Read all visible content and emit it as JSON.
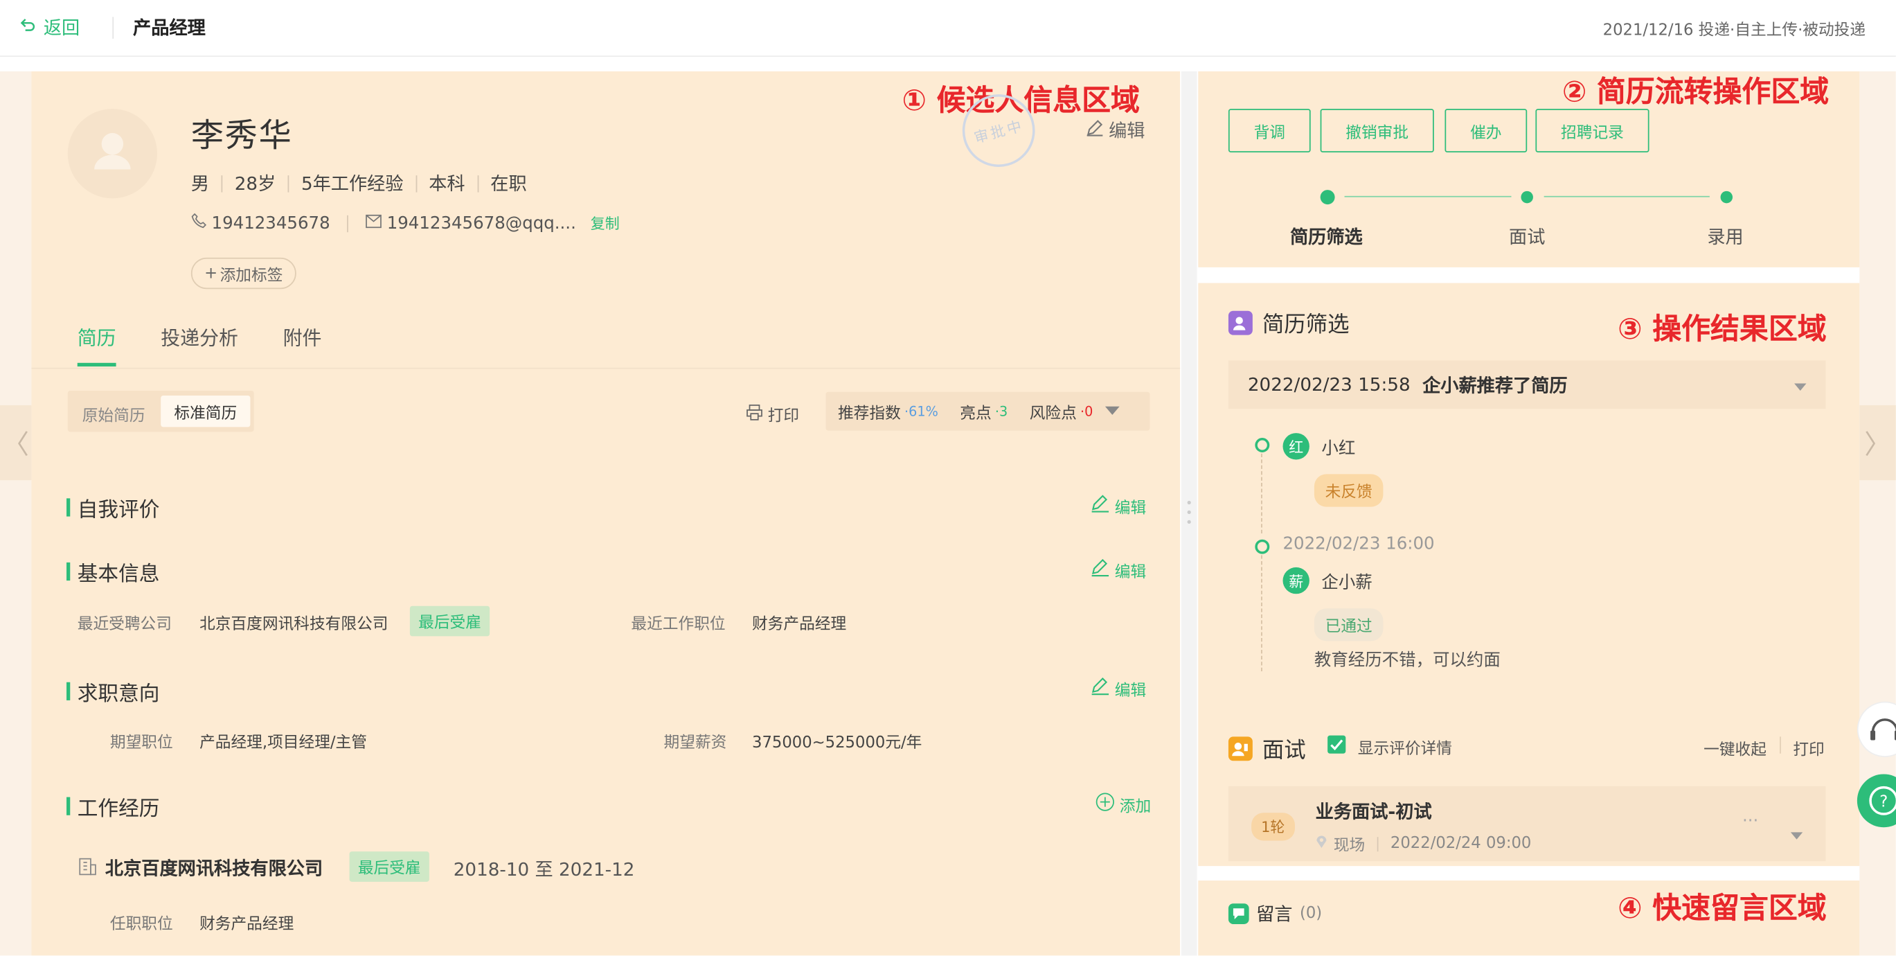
{
  "topbar": {
    "back_label": "返回",
    "page_title": "产品经理",
    "meta": "2021/12/16 投递·自主上传·被动投递"
  },
  "annotations": {
    "a1": "① 候选人信息区域",
    "a2": "② 简历流转操作区域",
    "a3": "③ 操作结果区域",
    "a4": "④ 快速留言区域"
  },
  "candidate": {
    "name": "李秀华",
    "stamp": "审批中",
    "edit_label": "编辑",
    "gender": "男",
    "age": "28岁",
    "experience": "5年工作经验",
    "education": "本科",
    "status": "在职",
    "phone": "19412345678",
    "email": "19412345678@qqq....",
    "copy_label": "复制",
    "add_tag_label": "添加标签"
  },
  "tabs": [
    {
      "label": "简历"
    },
    {
      "label": "投递分析"
    },
    {
      "label": "附件"
    }
  ],
  "resume_view": {
    "original_label": "原始简历",
    "standard_label": "标准简历",
    "print_label": "打印",
    "recommend_label": "推荐指数",
    "recommend_value": "·61%",
    "highlight_label": "亮点",
    "highlight_value": "·3",
    "risk_label": "风险点",
    "risk_value": "·0"
  },
  "sections": {
    "self_eval": {
      "title": "自我评价",
      "edit": "编辑"
    },
    "basic": {
      "title": "基本信息",
      "edit": "编辑",
      "company_label": "最近受聘公司",
      "company_value": "北京百度网讯科技有限公司",
      "company_badge": "最后受雇",
      "position_label": "最近工作职位",
      "position_value": "财务产品经理"
    },
    "intent": {
      "title": "求职意向",
      "edit": "编辑",
      "pos_label": "期望职位",
      "pos_value": "产品经理,项目经理/主管",
      "salary_label": "期望薪资",
      "salary_value": "375000~525000元/年"
    },
    "work": {
      "title": "工作经历",
      "add": "添加",
      "company": "北京百度网讯科技有限公司",
      "badge": "最后受雇",
      "period": "2018-10 至 2021-12",
      "role_label": "任职职位",
      "role_value": "财务产品经理"
    }
  },
  "actions": {
    "buttons": [
      "背调",
      "撤销审批",
      "催办",
      "招聘记录"
    ],
    "steps": [
      "简历筛选",
      "面试",
      "录用"
    ]
  },
  "screening": {
    "title": "简历筛选",
    "record": "2022/02/23 15:58",
    "record_action": "企小薪推荐了简历",
    "entries": [
      {
        "avatar": "红",
        "name": "小红",
        "status": "未反馈",
        "time": "",
        "comment": ""
      },
      {
        "avatar": "薪",
        "name": "企小薪",
        "status": "已通过",
        "time": "2022/02/23 16:00",
        "comment": "教育经历不错，可以约面"
      }
    ]
  },
  "interview": {
    "title": "面试",
    "show_detail": "显示评价详情",
    "collapse": "一键收起",
    "print": "打印",
    "round": "1轮",
    "name": "业务面试-初试",
    "place": "现场",
    "time": "2022/02/24 09:00",
    "more": "···"
  },
  "message": {
    "title": "留言",
    "count": "(0)"
  },
  "colors": {
    "accent": "#2dbd7a",
    "annotation": "#e8272b",
    "panel": "#fdebd3"
  }
}
